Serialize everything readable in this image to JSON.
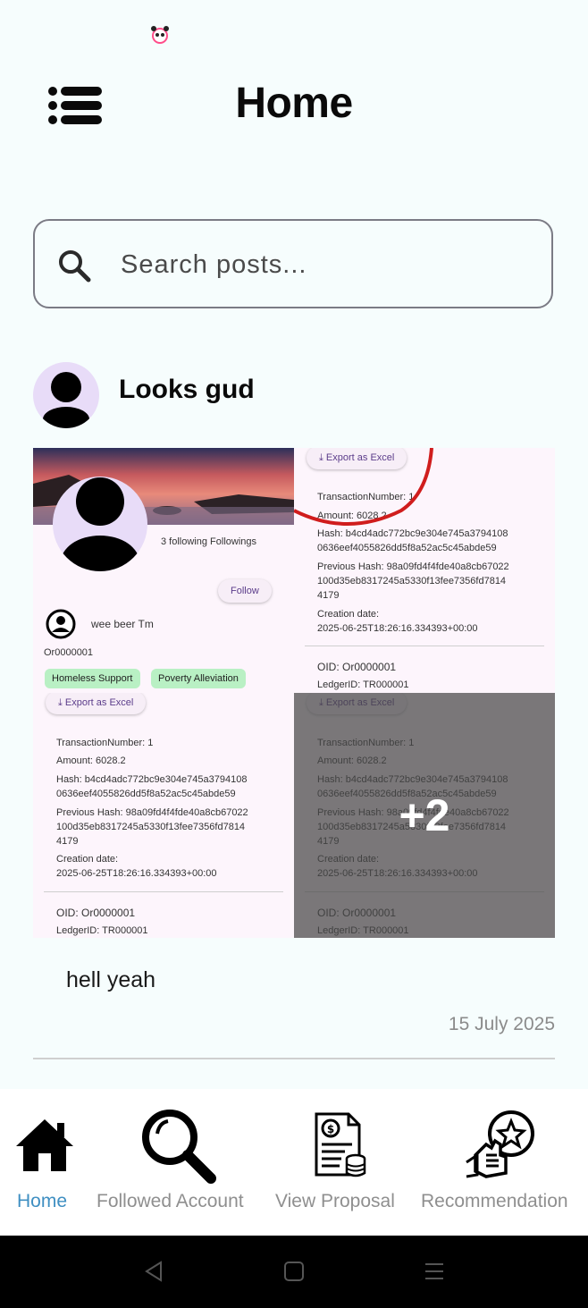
{
  "status_bar": {
    "icon": "panda-icon"
  },
  "header": {
    "title": "Home",
    "menu_icon": "menu-list-icon"
  },
  "search": {
    "placeholder": "Search posts...",
    "value": "",
    "icon": "search-icon"
  },
  "post": {
    "author": "Looks gud",
    "caption": "hell yeah",
    "date": "15 July 2025",
    "extra_images": "+2",
    "images": {
      "profile": {
        "following": "3 following Followings",
        "follow_label": "Follow",
        "user_name": "wee beer Tm",
        "org_id": "Or0000001",
        "tags": [
          "Homeless Support",
          "Poverty Alleviation"
        ]
      },
      "ledger": {
        "export_label": "Export as Excel",
        "transaction": "TransactionNumber: 1",
        "transaction_short": "TransactionNumber: 1",
        "amount": "Amount: 6028.2",
        "hash_line1": "Hash: b4cd4adc772bc9e304e745a3794108",
        "hash_line2": "0636eef4055826dd5f8a52ac5c45abde59",
        "prev_line1": "Previous Hash: 98a09fd4f4fde40a8cb67022",
        "prev_line2": "100d35eb8317245a5330f13fee7356fd7814",
        "prev_line3": "4179",
        "creation_label": "Creation date:",
        "creation_value": "2025-06-25T18:26:16.334393+00:00",
        "oid": "OID: Or0000001",
        "ledger_id": "LedgerID: TR000001"
      }
    }
  },
  "bottom_nav": {
    "items": [
      {
        "label": "Home",
        "icon": "home-icon",
        "active": true
      },
      {
        "label": "Followed Account",
        "icon": "magnifier-icon",
        "active": false
      },
      {
        "label": "View Proposal",
        "icon": "proposal-document-icon",
        "active": false
      },
      {
        "label": "Recommendation",
        "icon": "thumbs-up-star-icon",
        "active": false
      }
    ]
  },
  "colors": {
    "background": "#f6fdfd",
    "active_nav": "#3f8fc2",
    "inactive_nav": "#8f8f8f",
    "chip": "#b9f0c4",
    "avatar_bg": "#e8dcf8"
  }
}
